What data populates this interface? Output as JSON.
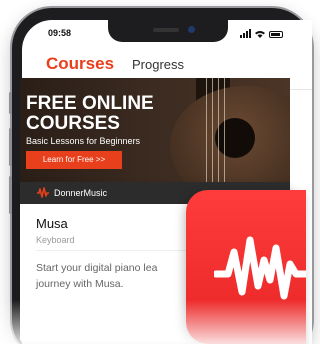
{
  "status_bar": {
    "time": "09:58",
    "icons": [
      "signal-icon",
      "wifi-icon",
      "battery-icon"
    ]
  },
  "tabs": [
    {
      "label": "Courses",
      "active": true
    },
    {
      "label": "Progress",
      "active": false
    }
  ],
  "banner": {
    "title_line1": "FREE ONLINE",
    "title_line2": "COURSES",
    "subtitle": "Basic Lessons for Beginners",
    "button_label": "Learn for Free >>"
  },
  "card": {
    "brand": "DonnerMusic",
    "title": "Musa",
    "subtitle": "Keyboard",
    "description": "Start your digital piano lea journey with Musa."
  },
  "colors": {
    "accent": "#e8401c",
    "app_icon": "#f02a2a",
    "card_header": "#2c2c2c"
  }
}
